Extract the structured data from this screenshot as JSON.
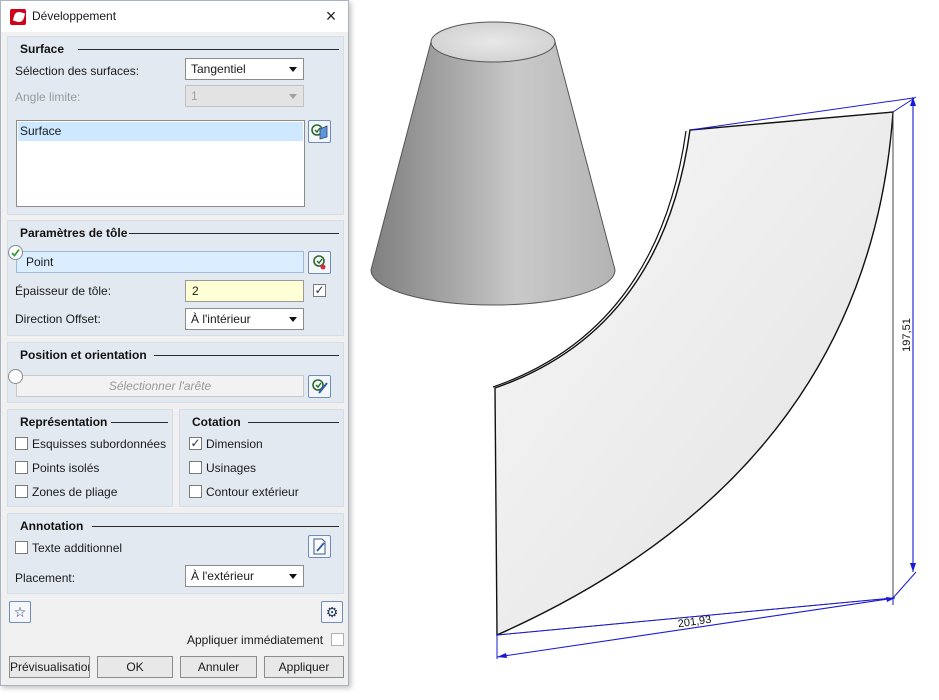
{
  "dialog": {
    "title": "Développement",
    "close_glyph": "×"
  },
  "surface": {
    "section_title": "Surface",
    "selection_label": "Sélection des surfaces:",
    "selection_value": "Tangentiel",
    "angle_label": "Angle limite:",
    "angle_value": "1",
    "list_items": [
      "Surface"
    ]
  },
  "sheet_params": {
    "section_title": "Paramètres de tôle",
    "point_value": "Point",
    "thickness_label": "Épaisseur de tôle:",
    "thickness_value": "2",
    "offset_label": "Direction Offset:",
    "offset_value": "À l'intérieur"
  },
  "position": {
    "section_title": "Position et orientation",
    "edge_placeholder": "Sélectionner l'arête"
  },
  "representation": {
    "section_title": "Représentation",
    "items": [
      "Esquisses subordonnées",
      "Points isolés",
      "Zones de pliage"
    ]
  },
  "cotation": {
    "section_title": "Cotation",
    "items": [
      "Dimension",
      "Usinages",
      "Contour extérieur"
    ]
  },
  "annotation": {
    "section_title": "Annotation",
    "text_label": "Texte additionnel",
    "placement_label": "Placement:",
    "placement_value": "À l'extérieur"
  },
  "footer": {
    "apply_immediately_label": "Appliquer immédiatement",
    "buttons": [
      "Prévisualisation",
      "OK",
      "Annuler",
      "Appliquer"
    ]
  },
  "viewport": {
    "dim_width": "201,93",
    "dim_height": "197,51"
  },
  "colors": {
    "accent": "#1a1ad6",
    "panel": "#e3e9f1",
    "selection": "#cde8ff"
  }
}
